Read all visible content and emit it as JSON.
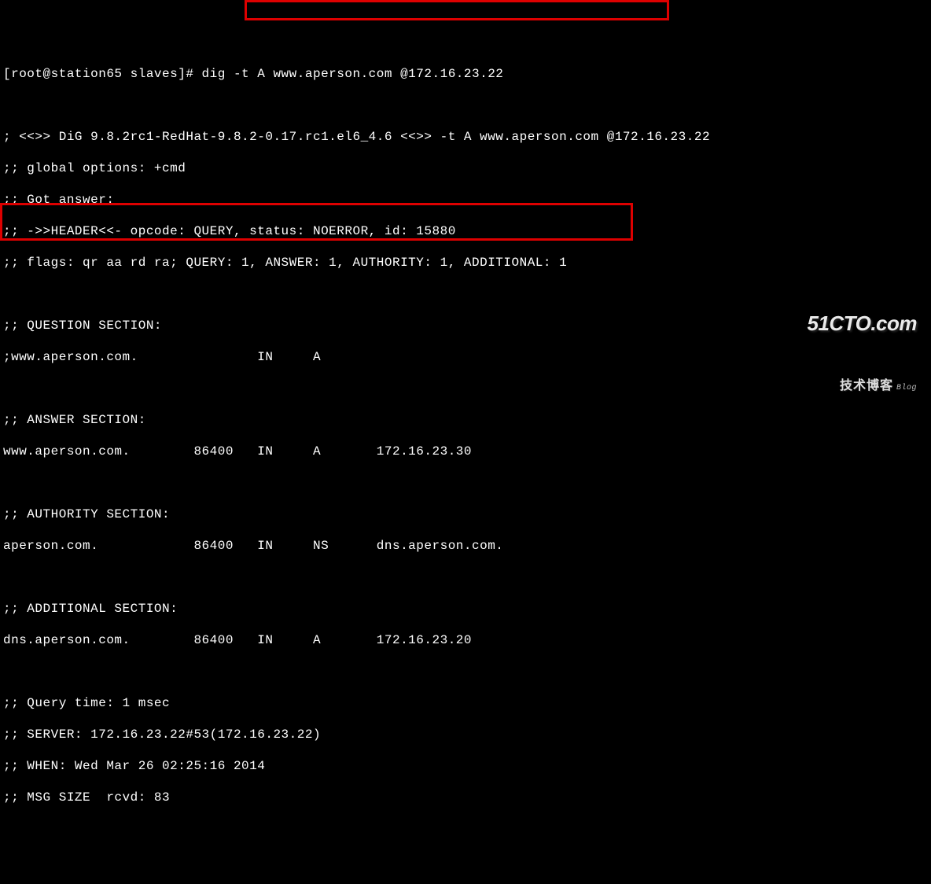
{
  "prompt_user": "[root@station65 slaves]# ",
  "command": "dig -t A www.aperson.com @172.16.23.22",
  "lines": {
    "l0": "[root@station65 slaves]# dig -t A www.aperson.com @172.16.23.22",
    "l1": "",
    "l2": "; <<>> DiG 9.8.2rc1-RedHat-9.8.2-0.17.rc1.el6_4.6 <<>> -t A www.aperson.com @172.16.23.22",
    "l3": ";; global options: +cmd",
    "l4": ";; Got answer:",
    "l5": ";; ->>HEADER<<- opcode: QUERY, status: NOERROR, id: 15880",
    "l6": ";; flags: qr aa rd ra; QUERY: 1, ANSWER: 1, AUTHORITY: 1, ADDITIONAL: 1",
    "l7": "",
    "l8": ";; QUESTION SECTION:",
    "l9": ";www.aperson.com.               IN     A",
    "l10": "",
    "l11": ";; ANSWER SECTION:",
    "l12": "www.aperson.com.        86400   IN     A       172.16.23.30",
    "l13": "",
    "l14": ";; AUTHORITY SECTION:",
    "l15": "aperson.com.            86400   IN     NS      dns.aperson.com.",
    "l16": "",
    "l17": ";; ADDITIONAL SECTION:",
    "l18": "dns.aperson.com.        86400   IN     A       172.16.23.20",
    "l19": "",
    "l20": ";; Query time: 1 msec",
    "l21": ";; SERVER: 172.16.23.22#53(172.16.23.22)",
    "l22": ";; WHEN: Wed Mar 26 02:25:16 2014",
    "l23": ";; MSG SIZE  rcvd: 83"
  },
  "dig_banner": "DiG 9.8.2rc1-RedHat-9.8.2-0.17.rc1.el6_4.6",
  "header": {
    "opcode": "QUERY",
    "status": "NOERROR",
    "id": "15880",
    "flags": "qr aa rd ra",
    "counts": {
      "QUERY": 1,
      "ANSWER": 1,
      "AUTHORITY": 1,
      "ADDITIONAL": 1
    }
  },
  "question_section": {
    "name": "www.aperson.com.",
    "class": "IN",
    "type": "A"
  },
  "answer_section": [
    {
      "name": "www.aperson.com.",
      "ttl": 86400,
      "class": "IN",
      "type": "A",
      "data": "172.16.23.30"
    }
  ],
  "authority_section": [
    {
      "name": "aperson.com.",
      "ttl": 86400,
      "class": "IN",
      "type": "NS",
      "data": "dns.aperson.com."
    }
  ],
  "additional_section": [
    {
      "name": "dns.aperson.com.",
      "ttl": 86400,
      "class": "IN",
      "type": "A",
      "data": "172.16.23.20"
    }
  ],
  "footer": {
    "query_time": "1 msec",
    "server": "172.16.23.22#53(172.16.23.22)",
    "when": "Wed Mar 26 02:25:16 2014",
    "msg_size": "rcvd: 83"
  },
  "watermark": {
    "line1": "51CTO.com",
    "line2": "技术博客",
    "blog": "Blog"
  }
}
